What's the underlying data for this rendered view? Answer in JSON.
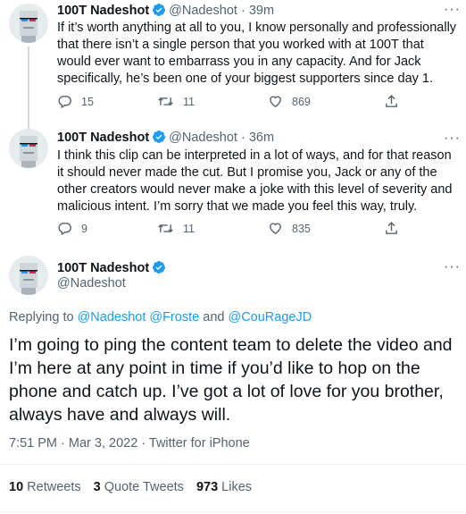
{
  "tweets": [
    {
      "name": "100T Nadeshot",
      "handle": "@Nadeshot",
      "separator": "·",
      "time": "39m",
      "text": "If it’s worth anything at all to you, I know personally and professionally that there isn’t a single person that you worked with at 100T that would ever want to embarrass you in any capacity. And for Jack specifically, he’s been one of your biggest supporters since day 1.",
      "replies": "15",
      "retweets": "11",
      "likes": "869"
    },
    {
      "name": "100T Nadeshot",
      "handle": "@Nadeshot",
      "separator": "·",
      "time": "36m",
      "text": "I think this clip can be interpreted in a lot of ways, and for that reason it should never made the cut. But I promise you, Jack or any of the other creators would never make a joke with this level of severity and malicious intent. I’m sorry that we made you feel this way, truly.",
      "replies": "9",
      "retweets": "11",
      "likes": "835"
    }
  ],
  "main_tweet": {
    "name": "100T Nadeshot",
    "handle": "@Nadeshot",
    "replying_prefix": "Replying to",
    "mentions": [
      "@Nadeshot",
      "@Froste",
      "@CouRageJD"
    ],
    "and_word": "and",
    "text": "I’m going to ping the content team to delete the video and I’m here at any point in time if you’d like to hop on the phone and catch up. I’ve got a lot of love for you brother, always have and always will.",
    "meta": "7:51 PM · Mar 3, 2022 · Twitter for iPhone",
    "retweets_count": "10",
    "retweets_label": "Retweets",
    "quotes_count": "3",
    "quotes_label": "Quote Tweets",
    "likes_count": "973",
    "likes_label": "Likes"
  },
  "more_icon_text": "···",
  "colors": {
    "accent": "#1d9bf0",
    "secondary": "#536471",
    "text": "#0f1419"
  }
}
